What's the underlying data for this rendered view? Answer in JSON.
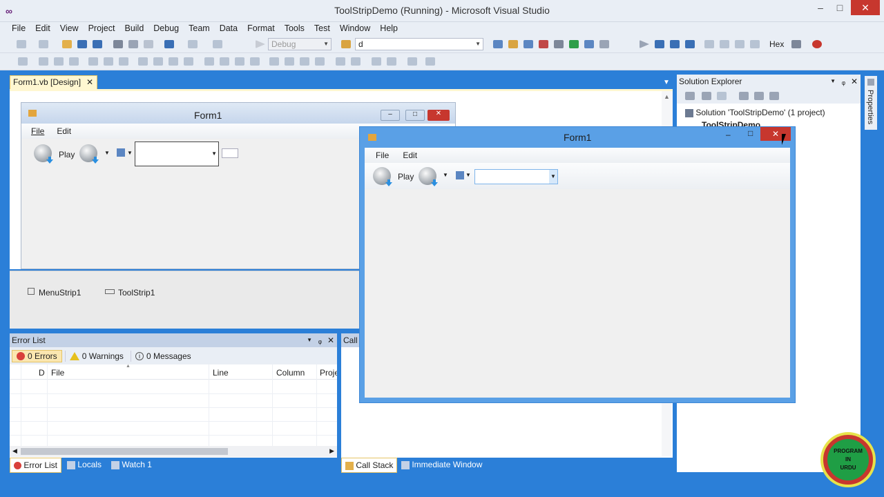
{
  "window": {
    "title": "ToolStripDemo (Running) - Microsoft Visual Studio"
  },
  "menu": [
    "File",
    "Edit",
    "View",
    "Project",
    "Build",
    "Debug",
    "Team",
    "Data",
    "Format",
    "Tools",
    "Test",
    "Window",
    "Help"
  ],
  "toolbar": {
    "config_value": "Debug",
    "find_value": "d",
    "hex_label": "Hex"
  },
  "doc_tab": {
    "label": "Form1.vb [Design]"
  },
  "designer": {
    "form_title": "Form1",
    "menu_file": "File",
    "menu_edit": "Edit",
    "play_label": "Play",
    "tray_menustrip": "MenuStrip1",
    "tray_toolstrip": "ToolStrip1"
  },
  "running_form": {
    "title": "Form1",
    "menu_file": "File",
    "menu_edit": "Edit",
    "play_label": "Play"
  },
  "solution_explorer": {
    "title": "Solution Explorer",
    "solution_label": "Solution 'ToolStripDemo' (1 project)",
    "project_label": "ToolStripDemo",
    "side_tab": "Properties"
  },
  "error_list": {
    "title": "Error List",
    "errors": "0 Errors",
    "warnings": "0 Warnings",
    "messages": "0 Messages",
    "columns": [
      "D",
      "File",
      "Line",
      "Column",
      "Proje"
    ]
  },
  "call_stack": {
    "title_partial": "Call S"
  },
  "bottom_tabs": {
    "left": [
      "Error List",
      "Locals",
      "Watch 1"
    ],
    "right": [
      "Call Stack",
      "Immediate Window"
    ]
  },
  "watermark": {
    "lines": [
      "PROGRAM",
      "IN",
      "URDU"
    ]
  },
  "colors": {
    "accent": "#007acc",
    "close_red": "#c7372e",
    "running_frame": "#5aa0e6",
    "tab_highlight": "#fff7d1"
  }
}
